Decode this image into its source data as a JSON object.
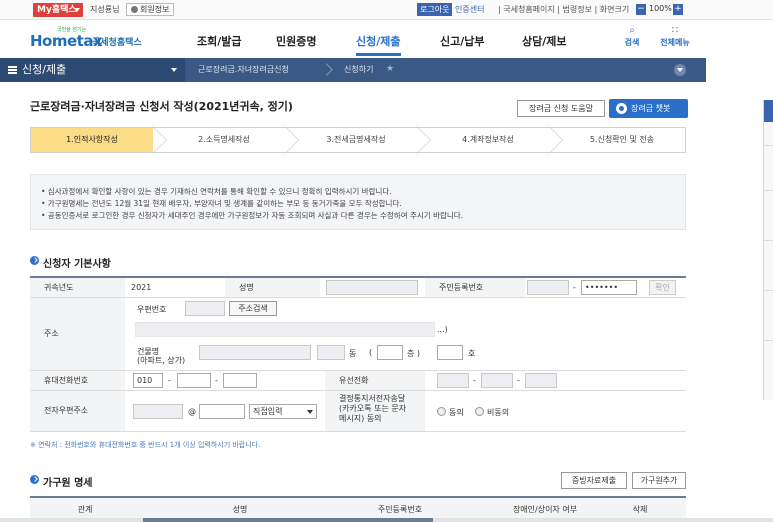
{
  "topbar": {
    "my_label": "My홈택스",
    "user_name": "지성룡님",
    "user_info": "회원정보",
    "logout": "로그아웃",
    "cert_center": "인증센터",
    "links": "| 국세청홈페이지 | 범령정보 | 화면크기",
    "zoom_minus": "−",
    "zoom_level": "100%",
    "zoom_plus": "+"
  },
  "gnb": {
    "logo_small": "국민을 섬기는",
    "logo_text": "Hometax",
    "logo_sub": "국세청홈택스",
    "menus": [
      "조회/발급",
      "민원증명",
      "신청/제출",
      "신고/납부",
      "상담/제보"
    ],
    "active_menu": "신청/제출",
    "search_label": "검색",
    "fullmenu_label": "전체메뉴"
  },
  "location": {
    "home": "신청/제출",
    "step1": "근로장려금.자녀장려금신청",
    "step2": "신청하기",
    "star": "★"
  },
  "page": {
    "title": "근로장려금·자녀장려금 신청서 작성(2021년귀속, 정기)",
    "help_button": "장려금 신청 도움말",
    "chatbot_button": "장려금 챗봇"
  },
  "steps": [
    {
      "label": "1.인적사항작성",
      "active": true
    },
    {
      "label": "2.소득명세작성",
      "active": false
    },
    {
      "label": "3.전세금명세작성",
      "active": false
    },
    {
      "label": "4.계좌정보작성",
      "active": false
    },
    {
      "label": "5.신청확인 및 전송",
      "active": false
    }
  ],
  "info": [
    "• 심사과정에서 확인할 사항이 있는 경우 기재하신 연락처를 통해 확인할 수 있으니 정확히 입력하시기 바랍니다.",
    "• 가구원명세는 전년도 12월 31일 현재 배우자, 부양자녀 및 생계를 같이하는 부모 등 동거가족을 모두 작성합니다.",
    "• 공동인증서로 로그인한 경우 신청자가 세대주인 경우에만 가구원정보가 자동 조회되며 사실과 다른 경우는 수정하여 주시기 바랍니다."
  ],
  "applicant": {
    "section_title": "신청자 기본사항",
    "year_label": "귀속년도",
    "year_value": "2021",
    "name_label": "성명",
    "rrn_label": "주민등록번호",
    "rrn_dash": "-",
    "rrn_back": "•••••••",
    "confirm_button": "확인",
    "address_label": "주소",
    "postcode_label": "우편번호",
    "address_search_button": "주소검색",
    "address_tail": "...)",
    "building_label": "건물명",
    "building_sub": "(아파트, 상가)",
    "dong": "동",
    "cheung_open": "(",
    "cheung": "층 )",
    "ho": "호",
    "mobile_label": "휴대전화번호",
    "mobile_prefix": "010",
    "dash": "-",
    "phone_label": "유선전화",
    "email_label": "전자우편주소",
    "at": "@",
    "email_select": "직접입력",
    "consent_label": "결정통지서전자송달\n(카카오톡 또는 문자\n메시지) 동의",
    "consent_yes": "동의",
    "consent_no": "비동의"
  },
  "note": "※ 연락처 : 전화번호와 휴대전화번호 중 반드시 1개 이상 입력하시기 바랍니다.",
  "household": {
    "section_title": "가구원 명세",
    "evidence_button": "증빙자료제출",
    "add_button": "가구원추가",
    "columns": [
      "관계",
      "성명",
      "주민등록번호",
      "장애인/상이자 여부",
      "삭제"
    ]
  },
  "colors": {
    "accent": "#2a6fc9",
    "nav": "#3a5a85",
    "active_step": "#fbdc86",
    "my_red": "#e0403a"
  }
}
